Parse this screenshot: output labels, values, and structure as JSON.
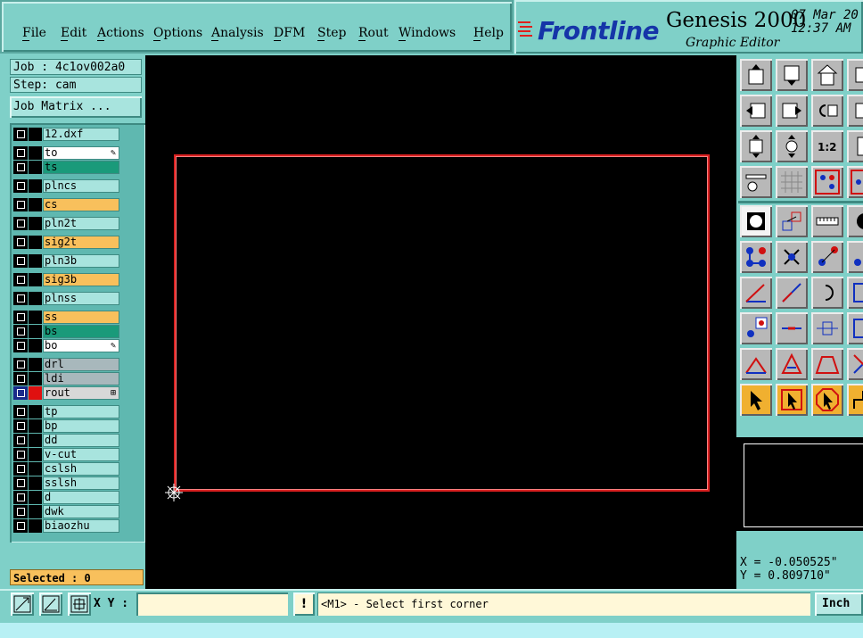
{
  "menu": [
    {
      "label": "File",
      "key": "F"
    },
    {
      "label": "Edit",
      "key": "E"
    },
    {
      "label": "Actions",
      "key": "A"
    },
    {
      "label": "Options",
      "key": "O"
    },
    {
      "label": "Analysis",
      "key": "A"
    },
    {
      "label": "DFM",
      "key": "D"
    },
    {
      "label": "Step",
      "key": "S"
    },
    {
      "label": "Rout",
      "key": "R"
    },
    {
      "label": "Windows",
      "key": "W"
    },
    {
      "label": "Help",
      "key": "H"
    }
  ],
  "brand": {
    "logo": "Frontline",
    "title": "Genesis 2000",
    "subtitle": "Graphic Editor",
    "date": "07 Mar 20",
    "time": "12:37 AM"
  },
  "job": {
    "job_label": "Job : 4c1ov002a0",
    "step_label": "Step: cam",
    "matrix_button": "Job Matrix ..."
  },
  "layers": [
    {
      "name": "12.dxf",
      "color": "#a8e4de",
      "swatch": "#000000",
      "mark": ""
    },
    {
      "name": "to",
      "color": "#ffffff",
      "swatch": "#000000",
      "mark": "pencil"
    },
    {
      "name": "ts",
      "color": "#1a9a7a",
      "swatch": "#000000",
      "mark": ""
    },
    {
      "name": "plncs",
      "color": "#a8e4de",
      "swatch": "#000000",
      "mark": ""
    },
    {
      "name": "cs",
      "color": "#f8c05c",
      "swatch": "#000000",
      "mark": ""
    },
    {
      "name": "pln2t",
      "color": "#a8e4de",
      "swatch": "#000000",
      "mark": ""
    },
    {
      "name": "sig2t",
      "color": "#f8c05c",
      "swatch": "#000000",
      "mark": ""
    },
    {
      "name": "pln3b",
      "color": "#a8e4de",
      "swatch": "#000000",
      "mark": ""
    },
    {
      "name": "sig3b",
      "color": "#f8c05c",
      "swatch": "#000000",
      "mark": ""
    },
    {
      "name": "plnss",
      "color": "#a8e4de",
      "swatch": "#000000",
      "mark": ""
    },
    {
      "name": "ss",
      "color": "#f8c05c",
      "swatch": "#000000",
      "mark": ""
    },
    {
      "name": "bs",
      "color": "#1a9a7a",
      "swatch": "#000000",
      "mark": ""
    },
    {
      "name": "bo",
      "color": "#ffffff",
      "swatch": "#000000",
      "mark": "pencil"
    },
    {
      "name": "drl",
      "color": "#a8b8bc",
      "swatch": "#000000",
      "mark": ""
    },
    {
      "name": "ldi",
      "color": "#a8b8bc",
      "swatch": "#000000",
      "mark": ""
    },
    {
      "name": "rout",
      "color": "#d8d8d8",
      "swatch": "#e01010",
      "mark": "grid",
      "active": true
    },
    {
      "name": "tp",
      "color": "#a8e4de",
      "swatch": "#000000",
      "mark": ""
    },
    {
      "name": "bp",
      "color": "#a8e4de",
      "swatch": "#000000",
      "mark": ""
    },
    {
      "name": "dd",
      "color": "#a8e4de",
      "swatch": "#000000",
      "mark": ""
    },
    {
      "name": "v-cut",
      "color": "#a8e4de",
      "swatch": "#000000",
      "mark": ""
    },
    {
      "name": "cslsh",
      "color": "#a8e4de",
      "swatch": "#000000",
      "mark": ""
    },
    {
      "name": "sslsh",
      "color": "#a8e4de",
      "swatch": "#000000",
      "mark": ""
    },
    {
      "name": "d",
      "color": "#a8e4de",
      "swatch": "#000000",
      "mark": ""
    },
    {
      "name": "dwk",
      "color": "#a8e4de",
      "swatch": "#000000",
      "mark": ""
    },
    {
      "name": "biaozhu",
      "color": "#a8e4de",
      "swatch": "#000000",
      "mark": ""
    }
  ],
  "selected": "Selected : 0",
  "tools": [
    "zoom-home-icon",
    "zoom-home-2-icon",
    "home-icon",
    "zoom-next-icon",
    "pan-left-icon",
    "pan-right-icon",
    "undo-zoom-icon",
    "zoom-right-icon",
    "fit-window-icon",
    "fit-profile-icon",
    "zoom-1-2-icon",
    "zoom-partial-icon",
    "tool-settings-icon",
    "grid-icon",
    "snap-active-icon",
    "snap-icon",
    "flash-pad-icon",
    "move-icon",
    "measure-icon",
    "pad-round-icon",
    "connect-nodes-icon",
    "delete-node-icon",
    "add-node-icon",
    "node-edit-icon",
    "line-angle-icon",
    "line-draw-icon",
    "arc-icon",
    "arc-edit-icon",
    "point-square-icon",
    "line-break-icon",
    "distance-icon",
    "bus-icon",
    "slope-icon",
    "triangle-icon",
    "trapezoid-icon",
    "cross-icon",
    "select-icon",
    "select-box-icon",
    "select-oct-icon",
    "select-step-icon"
  ],
  "coords": {
    "x": "X = -0.050525\"",
    "y": "Y = 0.809710\""
  },
  "bottom": {
    "xy_label": "X Y :",
    "xy_value": "",
    "warn": "!",
    "status": "<M1> - Select first corner",
    "unit": "Inch"
  }
}
